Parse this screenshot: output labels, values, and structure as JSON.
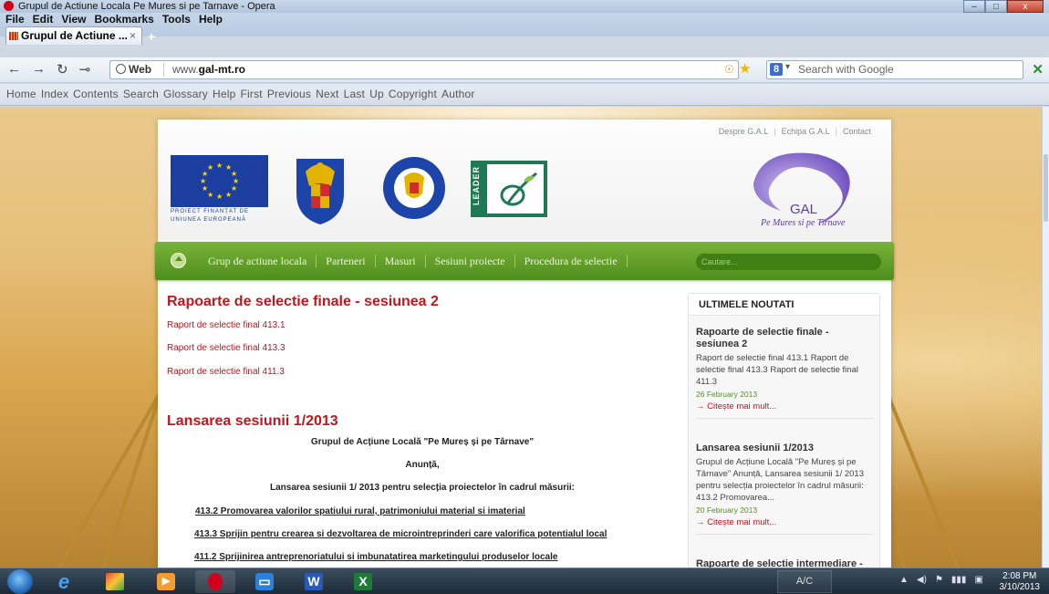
{
  "window": {
    "title": "Grupul de Actiune Locala Pe Mures si pe Tarnave - Opera",
    "min_glyph": "–",
    "max_glyph": "□",
    "close_glyph": "x"
  },
  "menubar": {
    "items": [
      "File",
      "Edit",
      "View",
      "Bookmarks",
      "Tools",
      "Help"
    ]
  },
  "tabs": [
    {
      "label": "Grupul de Actiune ...",
      "close": "×"
    }
  ],
  "new_tab": "+",
  "address": {
    "back": "←",
    "forward": "→",
    "reload": "↻",
    "key": "⊸",
    "web_label": "Web",
    "url_plain": "www.",
    "url_domain": "gal-mt.ro",
    "rss": "☉",
    "star": "★",
    "search_engine_glyph": "8",
    "search_caret": "▾",
    "search_placeholder": "Search with Google",
    "extension": "✕"
  },
  "navbar": {
    "links": [
      "Home",
      "Index",
      "Contents",
      "Search",
      "Glossary",
      "Help",
      "First",
      "Previous",
      "Next",
      "Last",
      "Up",
      "Copyright",
      "Author"
    ]
  },
  "site": {
    "top_links": [
      "Despre G.A.L",
      "|",
      "Echipa G.A.L",
      "|",
      "Contact"
    ],
    "eu_caption_1": "PROIECT FINANȚAT DE",
    "eu_caption_2": "UNIUNEA EUROPEANĂ",
    "leader_label": "LEADER",
    "gal_label": "GAL",
    "gal_sub": "Pe Mures si pe Tirnave",
    "menu_items": [
      "Grup de actiune locala",
      "Parteneri",
      "Masuri",
      "Sesiuni proiecte",
      "Procedura de selectie"
    ],
    "search_placeholder": "Cautare...",
    "section1": {
      "title": "Rapoarte de selectie finale - sesiunea 2",
      "links": [
        "Raport de selectie final 413.1",
        "Raport de selectie final 413.3",
        "Raport de selectie final 411.3"
      ]
    },
    "section2": {
      "title": "Lansarea sesiunii 1/2013",
      "p1": "Grupul de Acțiune Locală \"Pe Mureș și pe Târnave\"",
      "p2": "Anunță,",
      "p3": "Lansarea sesiunii 1/ 2013 pentru selecția proiectelor în cadrul măsurii:",
      "measures": [
        "413.2 Promovarea valorilor spatiului rural, patrimoniului material si imaterial",
        "413.3 Sprijin pentru crearea si dezvoltarea de microintreprinderi care valorifica potentialul   local",
        "411.2 Sprijinirea antreprenoriatului si imbunatatirea marketingului produselor locale"
      ]
    },
    "sidebar": {
      "heading": "ULTIMELE NOUTATI",
      "news": [
        {
          "title": "Rapoarte de selectie finale - sesiunea 2",
          "text": "Raport de selectie final 413.1 Raport de selectie final 413.3 Raport de selectie final 411.3",
          "date": "26 February 2013",
          "more": "→ Citește mai mult..."
        },
        {
          "title": "Lansarea sesiunii 1/2013",
          "text": "Grupul de Acțiune Locală \"Pe Mureș și pe Târnave\" Anunță, Lansarea sesiunii 1/ 2013 pentru selecția proiectelor în cadrul măsurii:  413.2 Promovarea...",
          "date": "20 February 2013",
          "more": "→ Citește mai mult..."
        },
        {
          "title": "Rapoarte de selectie intermediare -",
          "text": "",
          "date": "",
          "more": ""
        }
      ]
    }
  },
  "taskbar": {
    "ac_label": "A/C",
    "time": "2:08 PM",
    "date": "3/10/2013",
    "tray_icons": [
      "▲",
      "◀)",
      "⚑",
      "▮▮▮",
      "▣"
    ],
    "apps": [
      {
        "name": "internet-explorer",
        "glyph": "e",
        "color": "#3fa0ff"
      },
      {
        "name": "photos",
        "glyph": "⬛",
        "color": "#e0b03a"
      },
      {
        "name": "media-player",
        "glyph": "▶",
        "color": "#f39c33"
      },
      {
        "name": "opera",
        "glyph": "O",
        "color": "#d0021b"
      },
      {
        "name": "remote",
        "glyph": "▭",
        "color": "#2b80d8"
      },
      {
        "name": "word",
        "glyph": "W",
        "color": "#2a5ab8"
      },
      {
        "name": "excel",
        "glyph": "X",
        "color": "#1f7a3a"
      }
    ]
  }
}
